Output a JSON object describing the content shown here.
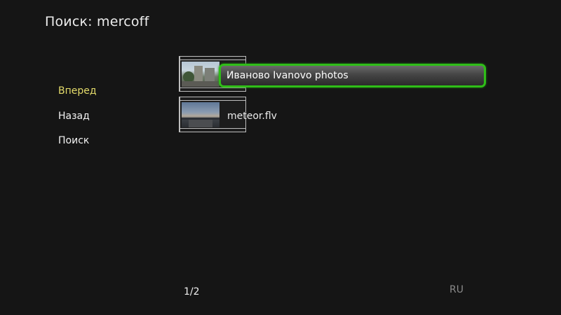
{
  "header": {
    "title": "Поиск: mercoff"
  },
  "side_menu": {
    "items": [
      {
        "label": "Вперед",
        "active": true
      },
      {
        "label": "Назад",
        "active": false
      },
      {
        "label": "Поиск",
        "active": false
      }
    ]
  },
  "results": {
    "items": [
      {
        "label": "Иваново Ivanovo photos",
        "thumbnail": "city-photo-thumbnail",
        "selected": true
      },
      {
        "label": "meteor.flv",
        "thumbnail": "video-thumbnail",
        "selected": false
      }
    ]
  },
  "footer": {
    "page_indicator": "1/2",
    "language": "RU"
  },
  "colors": {
    "background": "#151515",
    "active_menu_text": "#e5dc6b",
    "selection_border": "#2fbe18",
    "inactive_language": "#8a8a8a"
  }
}
